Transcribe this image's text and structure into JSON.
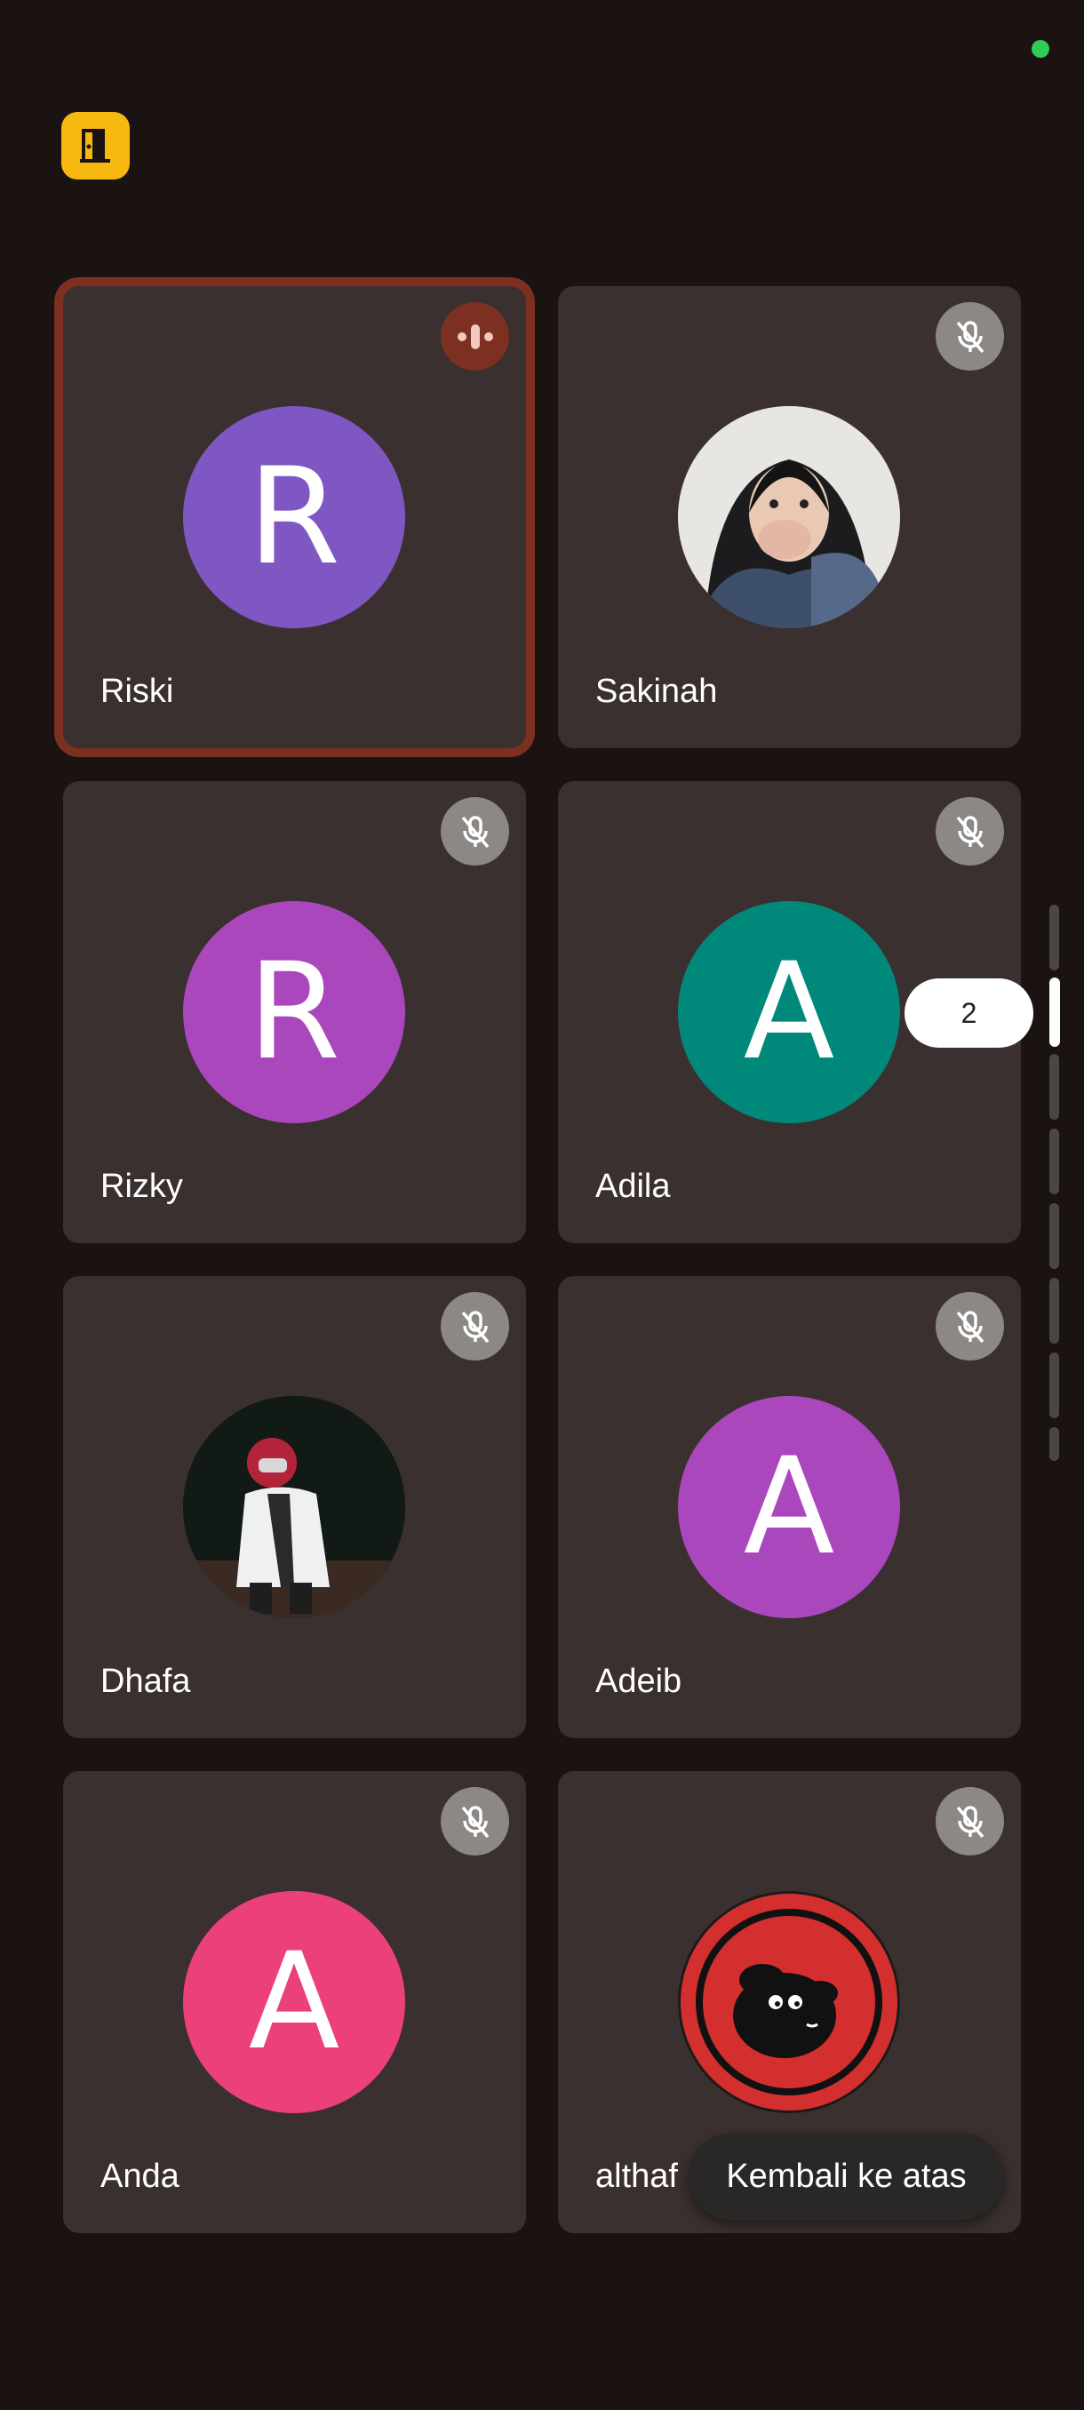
{
  "colors": {
    "background": "#1b1312",
    "tile": "#3a302f",
    "speaking_border": "#7d2f22",
    "leave_button": "#f7b90f",
    "status_dot": "#2ecc55"
  },
  "participants": [
    {
      "name": "Riski",
      "initial": "R",
      "avatar_color": "#7e57c2",
      "speaking": true
    },
    {
      "name": "Sakinah",
      "initial": "",
      "avatar_color": "#5a6273",
      "photo": true
    },
    {
      "name": "Rizky",
      "initial": "R",
      "avatar_color": "#ab47bc"
    },
    {
      "name": "Adila",
      "initial": "A",
      "avatar_color": "#00897b"
    },
    {
      "name": "Dhafa",
      "initial": "",
      "avatar_color": "#15201b",
      "photo": true
    },
    {
      "name": "Adeib",
      "initial": "A",
      "avatar_color": "#ab47bc"
    },
    {
      "name": "Anda",
      "initial": "A",
      "avatar_color": "#ec407a"
    },
    {
      "name": "althaf",
      "initial": "",
      "avatar_color": "#d32f2f",
      "photo": true
    }
  ],
  "scroll": {
    "page_label": "2"
  },
  "back_to_top_label": "Kembali ke atas",
  "icons": {
    "leave": "door-exit-icon",
    "muted": "mic-off-icon",
    "speaking": "audio-level-icon"
  }
}
